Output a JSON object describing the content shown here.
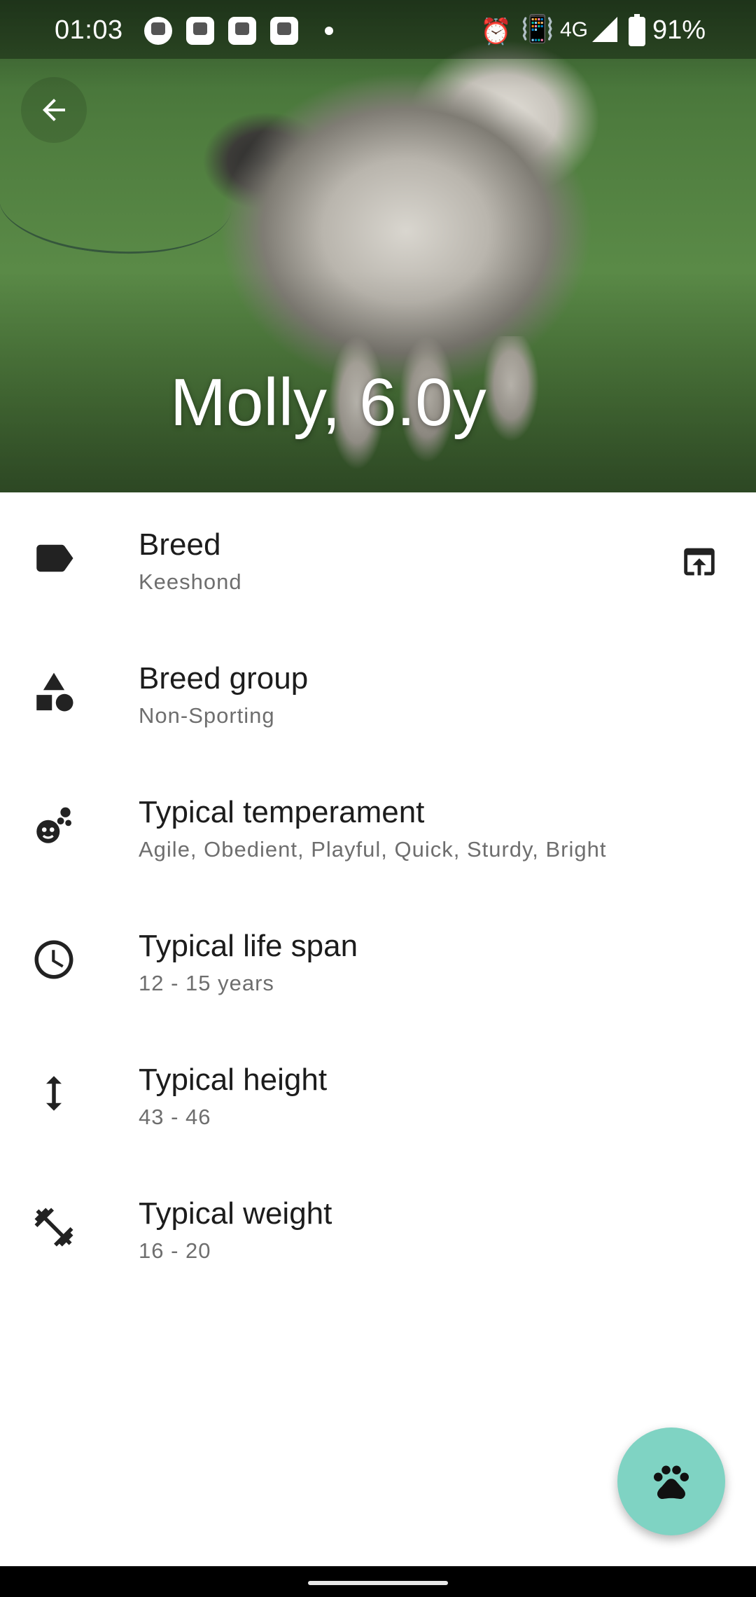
{
  "status_bar": {
    "time": "01:03",
    "network": "4G",
    "battery_percent": "91%"
  },
  "header": {
    "title": "Molly, 6.0y",
    "back_icon": "arrow-back-icon"
  },
  "details": [
    {
      "label": "Breed",
      "value": "Keeshond",
      "icon": "label-tag-icon",
      "action_icon": "open-in-browser-icon"
    },
    {
      "label": "Breed group",
      "value": "Non-Sporting",
      "icon": "category-shapes-icon"
    },
    {
      "label": "Typical temperament",
      "value": "Agile, Obedient, Playful, Quick, Sturdy, Bright",
      "icon": "temperament-icon"
    },
    {
      "label": "Typical life span",
      "value": "12 - 15 years",
      "icon": "clock-icon"
    },
    {
      "label": "Typical height",
      "value": "43 - 46",
      "icon": "height-arrows-icon"
    },
    {
      "label": "Typical weight",
      "value": "16 - 20",
      "icon": "dumbbell-icon"
    }
  ],
  "fab": {
    "icon": "paw-icon"
  },
  "colors": {
    "fab": "#7fd3c3",
    "label_text": "#1c1c1c",
    "value_text": "#6e6e6e"
  }
}
